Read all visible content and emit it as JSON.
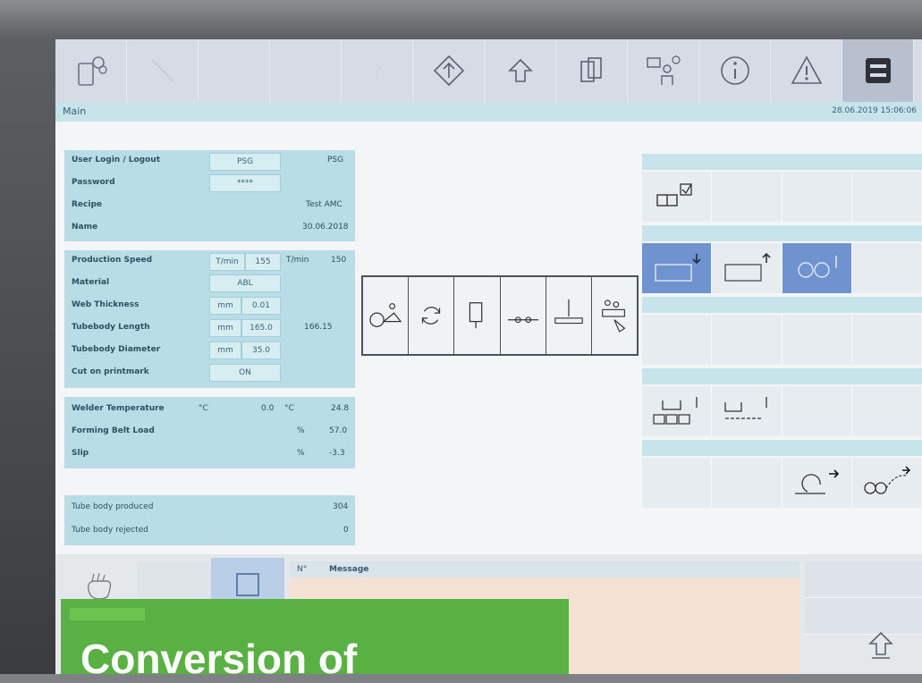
{
  "window": {
    "breadcrumb": "Main",
    "datetime": "28.06.2019 15:06:06"
  },
  "toolbar": {
    "buttons": [
      {
        "icon": "device-settings-icon"
      },
      {
        "icon": "disabled-icon"
      },
      {
        "icon": "blank-icon"
      },
      {
        "icon": "blank-icon"
      },
      {
        "icon": "help-icon"
      },
      {
        "icon": "start-diamond-icon"
      },
      {
        "icon": "home-arrow-icon"
      },
      {
        "icon": "pages-icon"
      },
      {
        "icon": "operator-icon"
      },
      {
        "icon": "info-icon"
      },
      {
        "icon": "warning-icon"
      },
      {
        "icon": "menu-icon"
      }
    ]
  },
  "login": {
    "user_label": "User Login / Logout",
    "user_value": "PSG",
    "user_display": "PSG",
    "password_label": "Password",
    "password_value": "****",
    "recipe_label": "Recipe",
    "recipe_value": "Test AMC",
    "name_label": "Name",
    "name_value": "30.06.2018"
  },
  "production": {
    "speed_label": "Production Speed",
    "speed_unit": "T/min",
    "speed_set": "155",
    "speed_unit2": "T/min",
    "speed_actual": "150",
    "material_label": "Material",
    "material_value": "ABL",
    "web_label": "Web Thickness",
    "web_unit": "mm",
    "web_value": "0.01",
    "length_label": "Tubebody Length",
    "length_unit": "mm",
    "length_value": "165.0",
    "length_actual": "166.15",
    "diameter_label": "Tubebody Diameter",
    "diameter_unit": "mm",
    "diameter_value": "35.0",
    "cut_label": "Cut on printmark",
    "cut_value": "ON"
  },
  "sensors": {
    "welder_label": "Welder Temperature",
    "welder_unit": "°C",
    "welder_set": "0.0",
    "welder_unit2": "°C",
    "welder_actual": "24.8",
    "belt_label": "Forming Belt Load",
    "belt_unit": "%",
    "belt_value": "57.0",
    "slip_label": "Slip",
    "slip_unit": "%",
    "slip_value": "-3.3"
  },
  "counts": {
    "produced_label": "Tube body produced",
    "produced_value": "304",
    "rejected_label": "Tube body rejected",
    "rejected_value": "0"
  },
  "messages": {
    "col_no": "N°",
    "col_message": "Message"
  },
  "banner": {
    "text": "Conversion of"
  },
  "colors": {
    "accent_blue": "#6e93cf",
    "panel": "#b8dde6",
    "banner_green": "#58b142"
  }
}
